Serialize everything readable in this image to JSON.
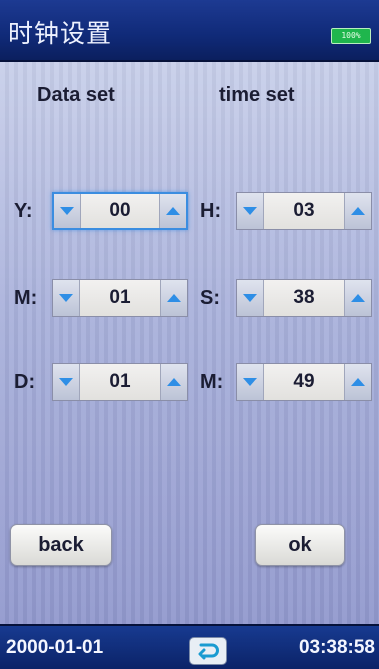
{
  "app": {
    "title": "时钟设置",
    "battery": "100%"
  },
  "headings": {
    "date_set": "Data set",
    "time_set": "time set"
  },
  "date_fields": [
    {
      "label": "Y:",
      "value": "00"
    },
    {
      "label": "M:",
      "value": "01"
    },
    {
      "label": "D:",
      "value": "01"
    }
  ],
  "time_fields": [
    {
      "label": "H:",
      "value": "03"
    },
    {
      "label": "S:",
      "value": "38"
    },
    {
      "label": "M:",
      "value": "49"
    }
  ],
  "buttons": {
    "back": "back",
    "ok": "ok"
  },
  "status": {
    "date": "2000-01-01",
    "time": "03:38:58",
    "return_icon": "return-icon"
  },
  "colors": {
    "title_bar": "#102a78",
    "accent_arrow": "#2e8ee6",
    "battery": "#1fb64d",
    "focus": "#3b8de0"
  }
}
